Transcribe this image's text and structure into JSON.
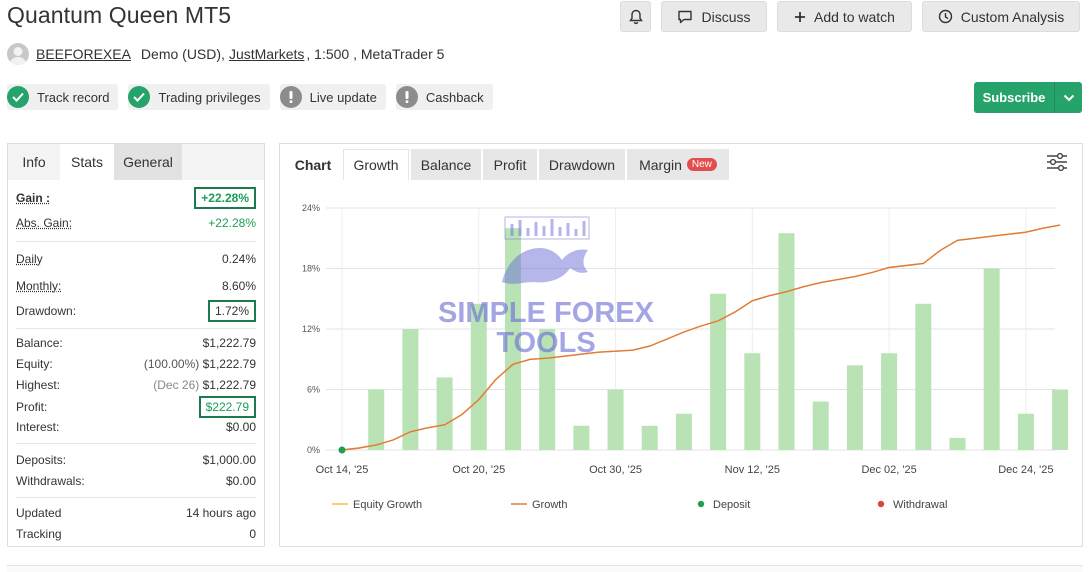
{
  "title": "Quantum Queen MT5",
  "header_buttons": {
    "discuss": "Discuss",
    "add_to_watch": "Add to watch",
    "custom_analysis": "Custom Analysis"
  },
  "account": {
    "author": "BEEFOREXEA",
    "type": "Demo (USD),",
    "broker": "JustMarkets",
    "leverage": ", 1:500 , MetaTrader 5"
  },
  "badges": [
    {
      "label": "Track record",
      "status": "ok"
    },
    {
      "label": "Trading privileges",
      "status": "ok"
    },
    {
      "label": "Live update",
      "status": "warn"
    },
    {
      "label": "Cashback",
      "status": "warn"
    }
  ],
  "subscribe": {
    "label": "Subscribe"
  },
  "stats_tabs": [
    "Info",
    "Stats",
    "General"
  ],
  "stats": {
    "gain": {
      "label": "Gain :",
      "value": "+22.28%"
    },
    "abs_gain": {
      "label": "Abs. Gain:",
      "value": "+22.28%"
    },
    "daily": {
      "label": "Daily",
      "value": "0.24%"
    },
    "monthly": {
      "label": "Monthly:",
      "value": "8.60%"
    },
    "drawdown": {
      "label": "Drawdown:",
      "value": "1.72%"
    },
    "balance": {
      "label": "Balance:",
      "value": "$1,222.79"
    },
    "equity": {
      "label": "Equity:",
      "note": "(100.00%)",
      "value": "$1,222.79"
    },
    "highest": {
      "label": "Highest:",
      "note": "(Dec 26)",
      "value": "$1,222.79"
    },
    "profit": {
      "label": "Profit:",
      "value": "$222.79"
    },
    "interest": {
      "label": "Interest:",
      "value": "$0.00"
    },
    "deposits": {
      "label": "Deposits:",
      "value": "$1,000.00"
    },
    "withdrawals": {
      "label": "Withdrawals:",
      "value": "$0.00"
    },
    "updated": {
      "label": "Updated",
      "value": "14 hours ago"
    },
    "tracking": {
      "label": "Tracking",
      "value": "0"
    }
  },
  "chart_tabs": {
    "label": "Chart",
    "tabs": [
      "Growth",
      "Balance",
      "Profit",
      "Drawdown",
      "Margin"
    ],
    "new_badge": "New"
  },
  "watermark": {
    "line1": "SIMPLE FOREX",
    "line2": "TOOLS"
  },
  "colors": {
    "accent_green": "#25a36a",
    "box_green": "#1e7a4e",
    "gain_green": "#1a9e55",
    "growth_line": "#e07a3c",
    "equity_line": "#f0c43c",
    "bar_fill": "#b9e2b5",
    "deposit_dot": "#1ea04e",
    "withdrawal_dot": "#d9463b",
    "watermark": "#6b6fd6"
  },
  "chart_data": {
    "type": "line",
    "y_ticks": [
      "0%",
      "6%",
      "12%",
      "18%",
      "24%"
    ],
    "ylim": [
      0,
      24
    ],
    "x_tick_labels": [
      "Oct 14, '25",
      "Oct 20, '25",
      "Oct 30, '25",
      "Nov 12, '25",
      "Dec 02, '25",
      "Dec 24, '25"
    ],
    "x_tick_index": [
      0,
      8,
      16,
      24,
      32,
      40
    ],
    "x_count": 43,
    "bars": {
      "positions": [
        2,
        4,
        6,
        8,
        10,
        12,
        14,
        16,
        18,
        20,
        22,
        24,
        26,
        28,
        30,
        32,
        34,
        36,
        38,
        40
      ],
      "values": [
        6.0,
        12.0,
        7.2,
        14.5,
        22.0,
        12.0,
        2.4,
        6.0,
        2.4,
        3.6,
        15.5,
        9.6,
        21.5,
        4.8,
        8.4,
        9.6,
        14.5,
        1.2,
        18.0,
        3.6
      ]
    },
    "bars_extra": [
      {
        "position": 42,
        "value": 6.0
      }
    ],
    "series": [
      {
        "name": "Equity Growth",
        "values": [
          0,
          0.2,
          0.5,
          1.0,
          1.8,
          2.2,
          2.5,
          3.5,
          5.0,
          7.0,
          8.5,
          9.0,
          9.1,
          9.3,
          9.5,
          9.7,
          9.8,
          9.9,
          10.3,
          11.0,
          11.7,
          12.3,
          12.8,
          13.7,
          14.8,
          15.3,
          15.7,
          16.2,
          16.6,
          16.9,
          17.2,
          17.6,
          18.1,
          18.3,
          18.5,
          19.8,
          20.8,
          21.0,
          21.2,
          21.4,
          21.6,
          22.0,
          22.3
        ]
      },
      {
        "name": "Growth",
        "values": [
          0,
          0.2,
          0.5,
          1.0,
          1.8,
          2.2,
          2.5,
          3.5,
          5.0,
          7.0,
          8.5,
          9.0,
          9.1,
          9.3,
          9.5,
          9.7,
          9.8,
          9.9,
          10.3,
          11.0,
          11.7,
          12.3,
          12.8,
          13.7,
          14.8,
          15.3,
          15.7,
          16.2,
          16.6,
          16.9,
          17.2,
          17.6,
          18.1,
          18.3,
          18.5,
          19.8,
          20.8,
          21.0,
          21.2,
          21.4,
          21.6,
          22.0,
          22.3
        ]
      }
    ],
    "deposit_points": [
      {
        "index": 0,
        "value": 0
      }
    ],
    "legend": [
      "Equity Growth",
      "Growth",
      "Deposit",
      "Withdrawal"
    ],
    "legend_position": "bottom",
    "grid": true
  }
}
